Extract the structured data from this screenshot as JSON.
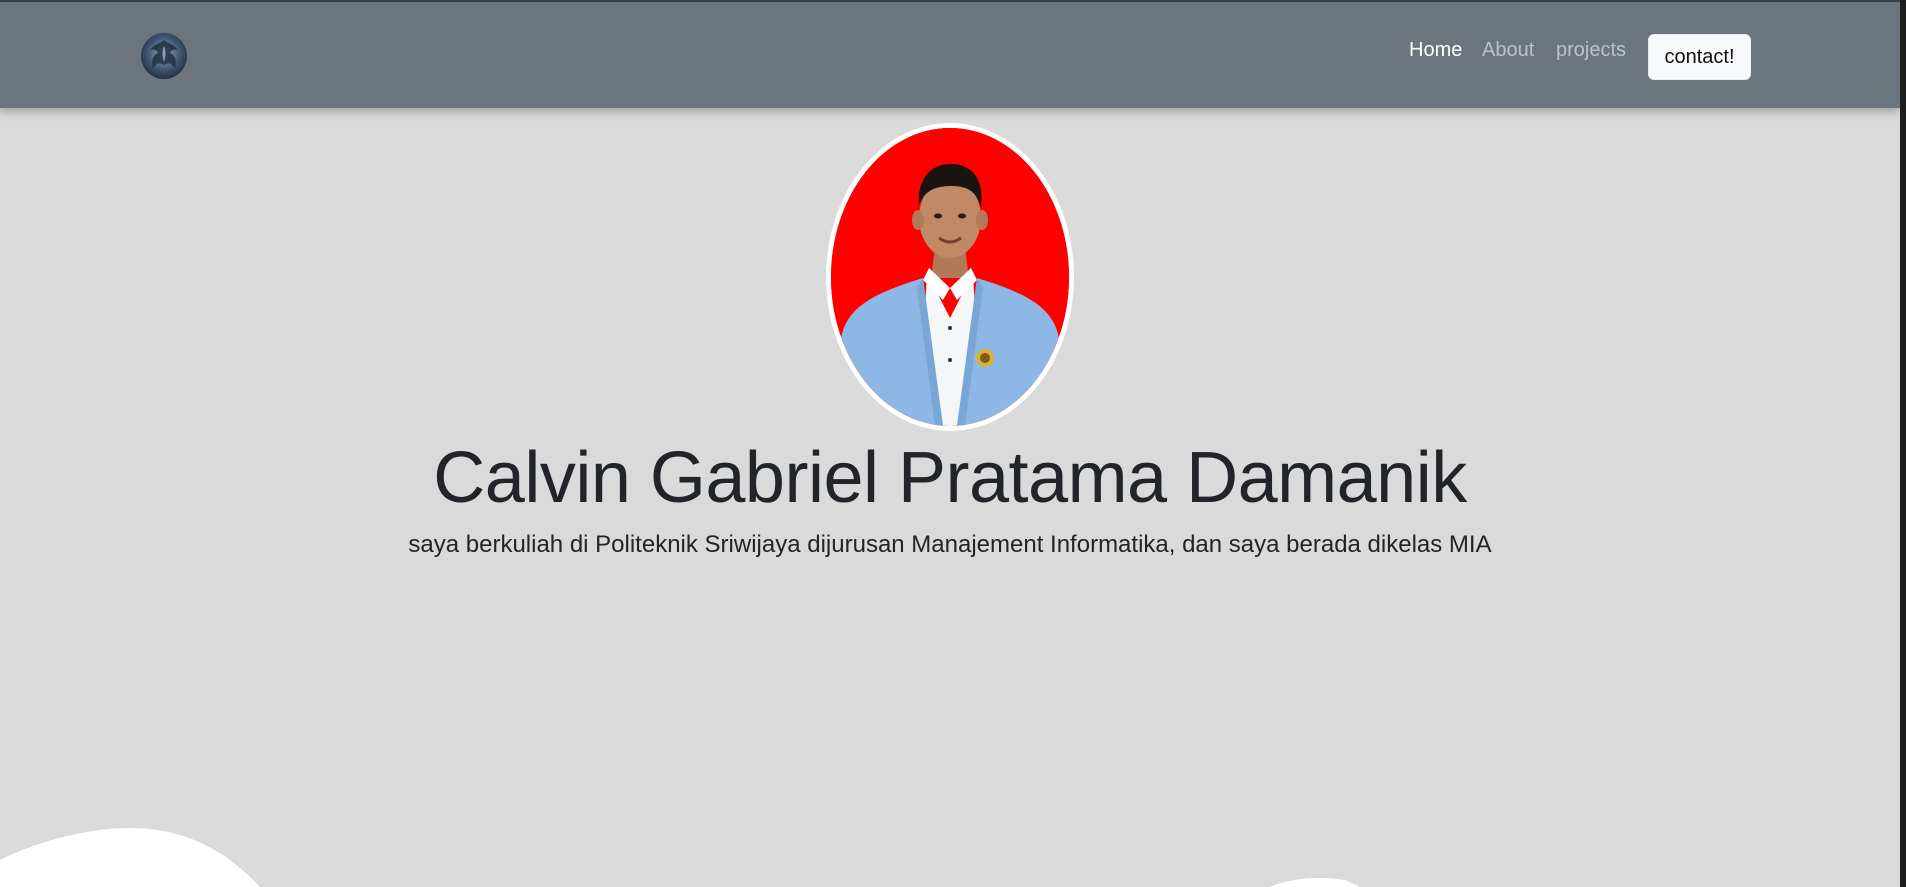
{
  "navbar": {
    "brand_icon": "phoenix-logo-icon",
    "links": [
      {
        "label": "Home",
        "active": true
      },
      {
        "label": "About",
        "active": false
      },
      {
        "label": "projects",
        "active": false
      }
    ],
    "cta_label": "contact!"
  },
  "hero": {
    "photo_icon": "profile-photo",
    "title": "Calvin Gabriel Pratama Damanik",
    "lead": "saya berkuliah di Politeknik Sriwijaya dijurusan Manajement Informatika, dan saya berada dikelas MIA"
  },
  "colors": {
    "navbar_bg": "#6c757d",
    "page_bg": "#dadada",
    "photo_bg": "#ff0000",
    "text": "#212529",
    "wave": "#ffffff"
  }
}
